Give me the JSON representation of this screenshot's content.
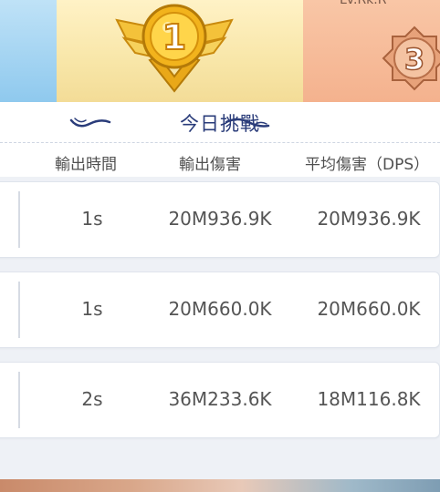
{
  "banner": {
    "top_right_name": "Lv.Rk.R",
    "first_place_number": "1",
    "third_place_number": "3"
  },
  "title": "今日挑戰",
  "columns": {
    "time": "輸出時間",
    "damage": "輸出傷害",
    "dps": "平均傷害（DPS）"
  },
  "records": [
    {
      "time": "1s",
      "damage": "20M936.9K",
      "dps": "20M936.9K"
    },
    {
      "time": "1s",
      "damage": "20M660.0K",
      "dps": "20M660.0K"
    },
    {
      "time": "2s",
      "damage": "36M233.6K",
      "dps": "18M116.8K"
    }
  ],
  "colors": {
    "title": "#2a3c7a",
    "gold_medal": "#f2b31c",
    "bronze_medal": "#d98a5c"
  }
}
